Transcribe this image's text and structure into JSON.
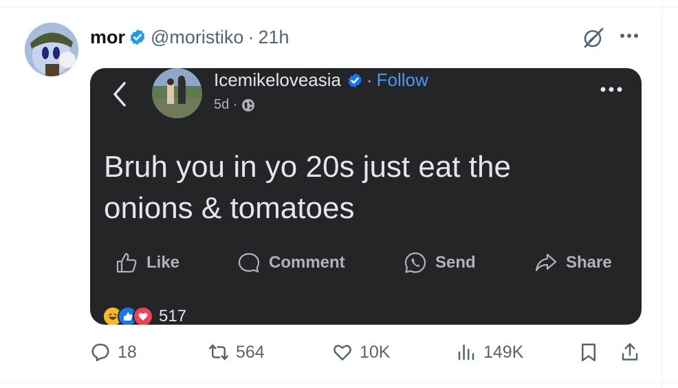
{
  "tweet": {
    "display_name": "mor",
    "handle": "@moristiko",
    "separator": "·",
    "time": "21h",
    "verified_color": "#1d9bf0",
    "icons": [
      "verified-badge-icon",
      "grok-icon",
      "more-options-icon"
    ]
  },
  "embedded_post": {
    "name": "Icemikeloveasia",
    "separator": "·",
    "follow_label": "Follow",
    "age": "5d ·",
    "text_line1": "Bruh you in yo 20s just eat the",
    "text_line2": "onions & tomatoes",
    "actions": {
      "like": "Like",
      "comment": "Comment",
      "send": "Send",
      "share": "Share"
    },
    "reaction_count": "517",
    "colors": {
      "background": "#242526",
      "follow": "#4599ff",
      "text": "#e4e6eb"
    }
  },
  "tweet_actions": {
    "replies": "18",
    "reposts": "564",
    "likes": "10K",
    "views": "149K"
  }
}
